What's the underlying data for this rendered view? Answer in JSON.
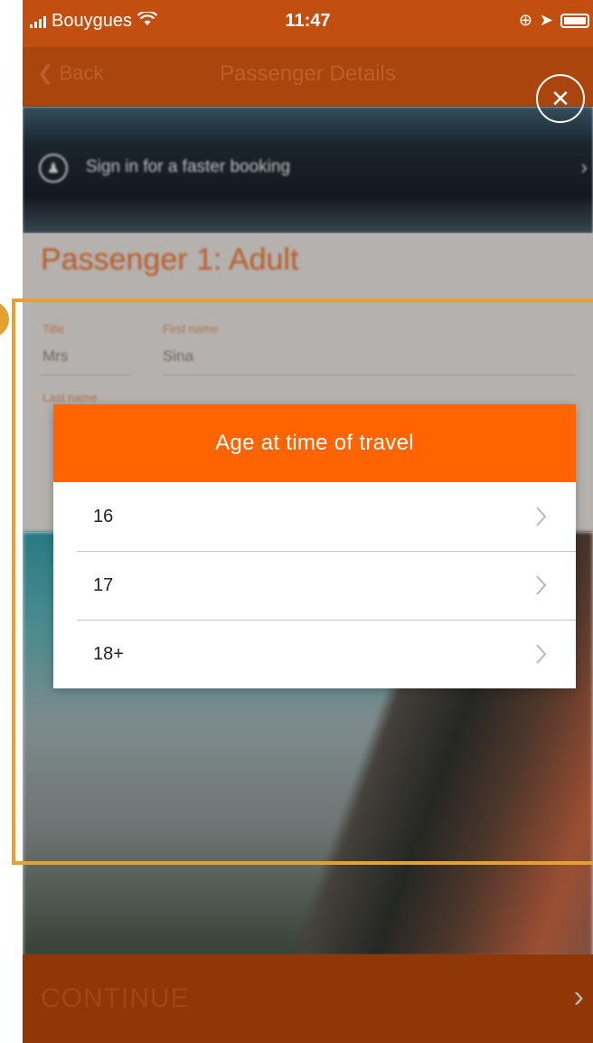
{
  "status_bar": {
    "carrier": "Bouygues",
    "time": "11:47"
  },
  "navbar": {
    "back_label": "Back",
    "title": "Passenger Details"
  },
  "signin_banner": {
    "text": "Sign in for a faster booking"
  },
  "form": {
    "heading": "Passenger 1: Adult",
    "title_label": "Title",
    "title_value": "Mrs",
    "first_name_label": "First name",
    "first_name_value": "Sina",
    "last_name_label": "Last name"
  },
  "continue": {
    "label": "CONTINUE"
  },
  "modal": {
    "title": "Age at time of travel",
    "options": [
      {
        "label": "16"
      },
      {
        "label": "17"
      },
      {
        "label": "18+"
      }
    ]
  },
  "colors": {
    "brand_orange": "#ff6400",
    "highlight": "#e4a12f"
  }
}
